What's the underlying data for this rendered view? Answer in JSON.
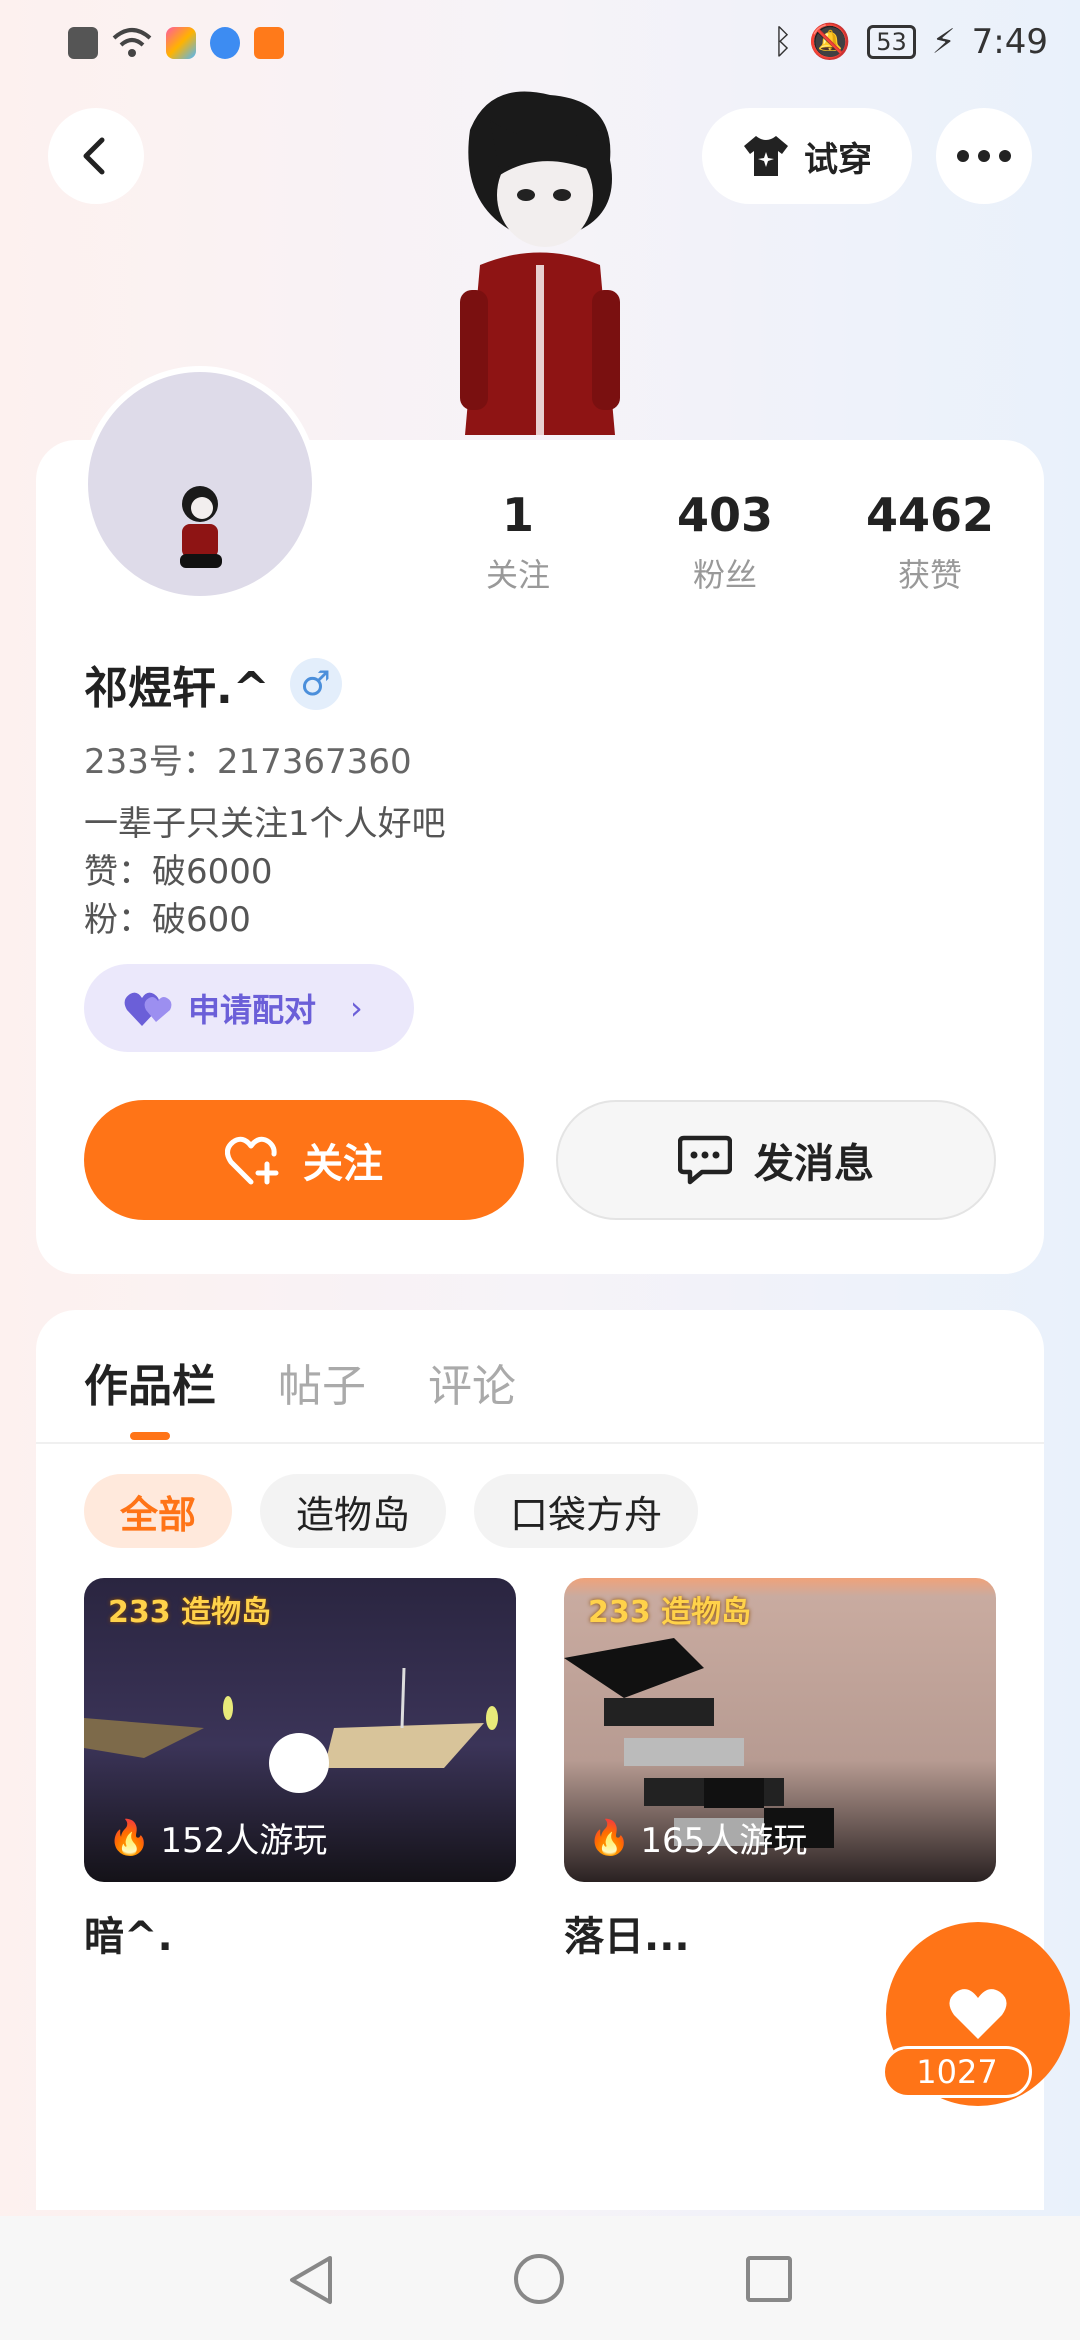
{
  "status_bar": {
    "battery": "53",
    "time": "7:49"
  },
  "top_bar": {
    "try_on_label": "试穿"
  },
  "profile": {
    "username": "祁煜轩.^",
    "gender_symbol": "♂",
    "uid": "233号：217367360",
    "bio": [
      "一辈子只关注1个人好吧",
      "赞：破6000",
      "粉：破600"
    ],
    "stats": [
      {
        "value": "1",
        "label": "关注"
      },
      {
        "value": "403",
        "label": "粉丝"
      },
      {
        "value": "4462",
        "label": "获赞"
      }
    ],
    "pair_label": "申请配对",
    "follow_label": "关注",
    "message_label": "发消息"
  },
  "tabs": [
    "作品栏",
    "帖子",
    "评论"
  ],
  "filters": [
    "全部",
    "造物岛",
    "口袋方舟"
  ],
  "games": [
    {
      "title": "暗^.",
      "players": "152人游玩",
      "logo": "233 造物岛"
    },
    {
      "title": "落日...",
      "players": "165人游玩",
      "logo": "233 造物岛"
    }
  ],
  "likes_fab": {
    "count": "1027"
  },
  "colors": {
    "accent": "#ff7417",
    "pair": "#6b5fd8"
  }
}
